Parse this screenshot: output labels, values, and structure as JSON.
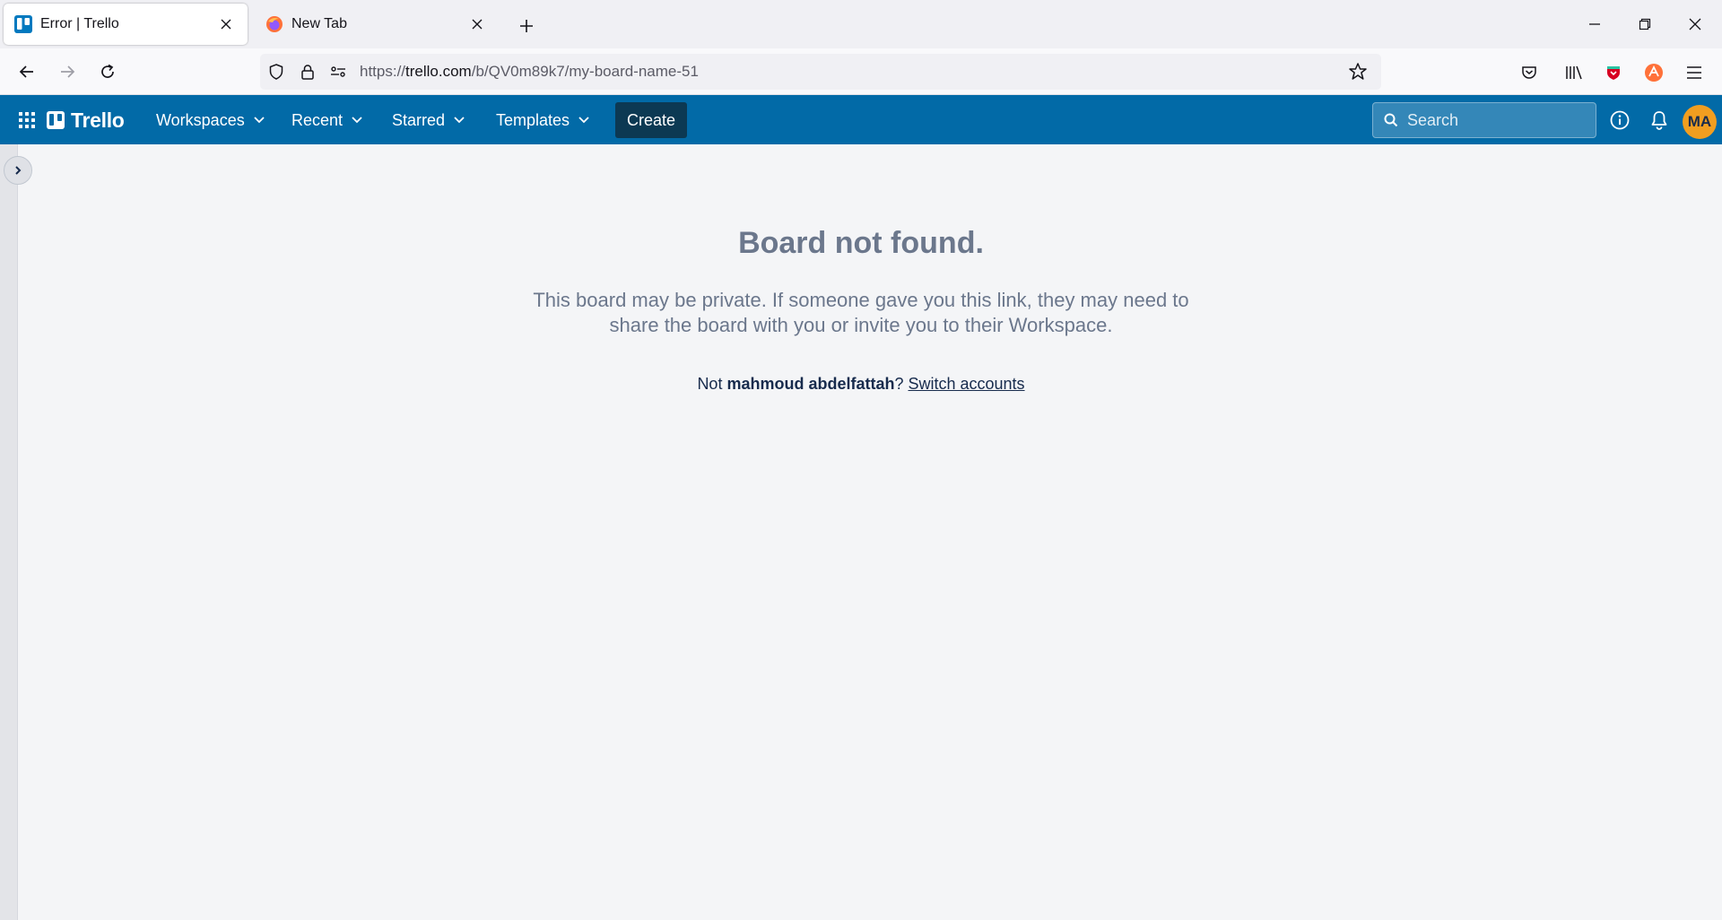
{
  "browser": {
    "tabs": [
      {
        "title": "Error | Trello",
        "active": true
      },
      {
        "title": "New Tab",
        "active": false
      }
    ],
    "url_prefix": "https://",
    "url_domain": "trello.com",
    "url_path": "/b/QV0m89k7/my-board-name-51"
  },
  "header": {
    "logo_text": "Trello",
    "menus": [
      "Workspaces",
      "Recent",
      "Starred",
      "Templates"
    ],
    "create_label": "Create",
    "search_placeholder": "Search",
    "avatar_initials": "MA"
  },
  "error": {
    "title": "Board not found.",
    "body": "This board may be private. If someone gave you this link, they may need to share the board with you or invite you to their Workspace.",
    "account_prefix": "Not ",
    "account_name": "mahmoud abdelfattah",
    "account_suffix": "? ",
    "switch_link": "Switch accounts"
  },
  "colors": {
    "header_bg": "#026aa7",
    "create_bg": "#0c3953",
    "avatar_bg": "#f19e20",
    "page_bg": "#f4f5f7"
  }
}
